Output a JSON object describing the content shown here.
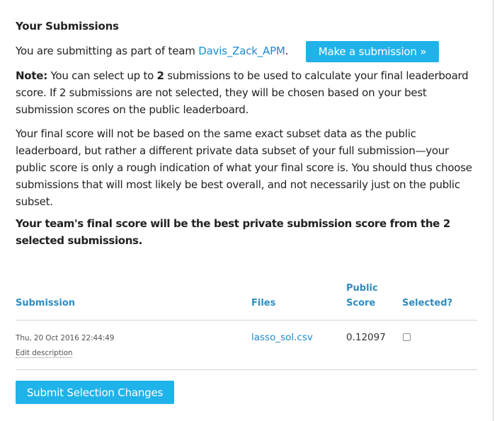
{
  "section": {
    "heading": "Your Submissions",
    "team_prefix": "You are submitting as part of team ",
    "team_name": "Davis_Zack_APM",
    "team_suffix": ".",
    "make_submission_label": "Make a submission »"
  },
  "note": {
    "label": "Note:",
    "text_before": " You can select up to ",
    "count": "2",
    "text_after": " submissions to be used to calculate your final leaderboard score. If 2 submissions are not selected, they will be chosen based on your best submission scores on the public leaderboard."
  },
  "final_score_text": "Your final score will not be based on the same exact subset data as the public leaderboard, but rather a different private data subset of your full submission—your public score is only a rough indication of what your final score is. You should thus choose submissions that will most likely be best overall, and not necessarily just on the public subset.",
  "team_final_text": "Your team's final score will be the best private submission score from the 2 selected submissions.",
  "table": {
    "headers": {
      "submission": "Submission",
      "files": "Files",
      "public_score": "Public Score",
      "selected": "Selected?"
    },
    "rows": [
      {
        "date": "Thu, 20 Oct 2016 22:44:49",
        "edit_label": "Edit description",
        "file": "lasso_sol.csv",
        "score": "0.12097",
        "selected": false
      }
    ]
  },
  "submit_selection_label": "Submit Selection Changes",
  "colors": {
    "accent": "#20b3ea",
    "link": "#1a8ccf",
    "header_text": "#2f8cc0"
  }
}
